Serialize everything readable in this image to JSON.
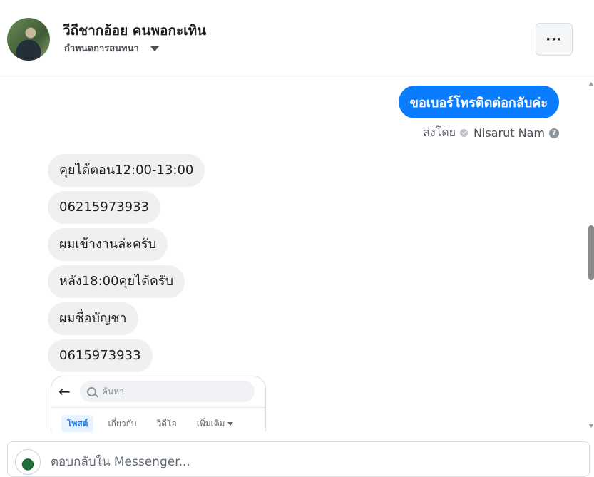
{
  "header": {
    "contact_name": "วีถีชากอ้อย คนพอกะเทิน",
    "conversation_settings": "กำหนดการสนทนา",
    "more_label": "···"
  },
  "outgoing": {
    "message": "ขอเบอร์โทรติดต่อกลับค่ะ",
    "sent_by_label": "ส่งโดย",
    "sender_name": "Nisarut Nam",
    "help_glyph": "?"
  },
  "incoming": [
    "คุยได้ตอน12:00-13:00",
    "06215973933",
    "ผมเข้างานล่ะครับ",
    "หลัง18:00คุยได้ครับ",
    "ผมชื่อบัญชา",
    "0615973933"
  ],
  "attachment": {
    "back_glyph": "←",
    "search_placeholder": "ค้นหา",
    "tabs": [
      "โพสต์",
      "เกี่ยวกับ",
      "วิดีโอ",
      "เพิ่มเติม"
    ]
  },
  "composer": {
    "placeholder": "ตอบกลับใน Messenger..."
  },
  "colors": {
    "outgoing_bubble": "#0a7cff",
    "incoming_bubble": "#f0f0f0"
  }
}
